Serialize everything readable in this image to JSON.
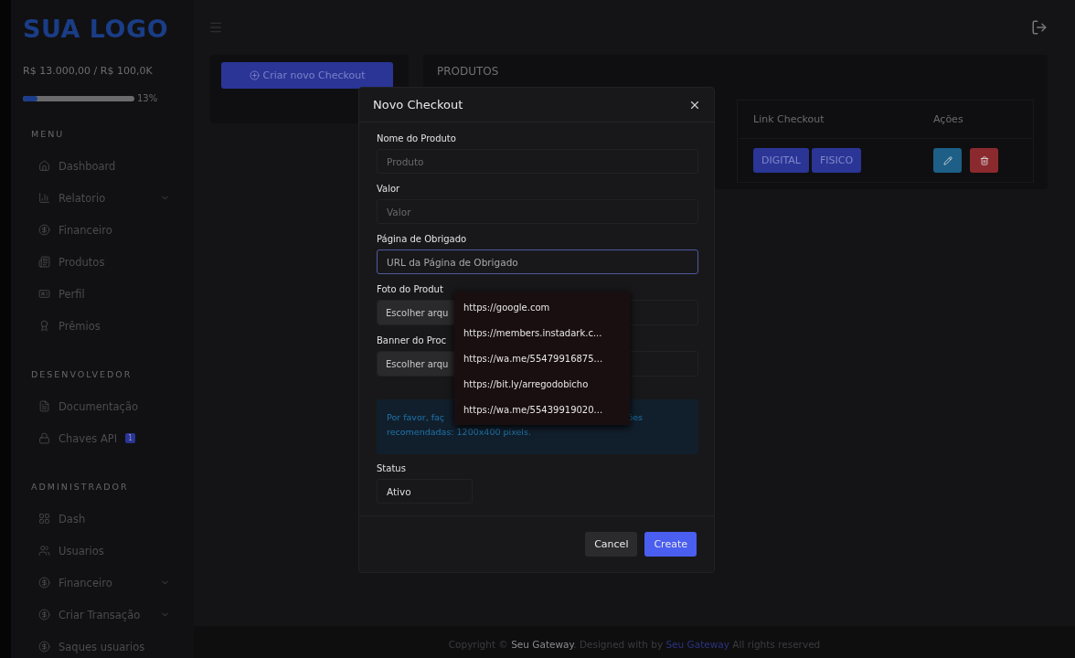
{
  "sidebar": {
    "logo": "SUA LOGO",
    "balance": "R$ 13.000,00 / R$ 100,0K",
    "progress": {
      "level": 0.13,
      "reading": "13%"
    },
    "sections": [
      {
        "title": "MENU",
        "items": [
          {
            "label": "Dashboard",
            "kind": "home",
            "expandable": false
          },
          {
            "label": "Relatorio",
            "kind": "chart",
            "expandable": true
          },
          {
            "label": "Financeiro",
            "kind": "dollar",
            "expandable": false
          },
          {
            "label": "Produtos",
            "kind": "news",
            "expandable": false
          },
          {
            "label": "Perfil",
            "kind": "card",
            "expandable": false
          },
          {
            "label": "Prêmios",
            "kind": "award",
            "expandable": false
          }
        ]
      },
      {
        "title": "DESENVOLVEDOR",
        "items": [
          {
            "label": "Documentação",
            "kind": "doc",
            "expandable": false
          },
          {
            "label": "Chaves API",
            "kind": "lock",
            "expandable": false,
            "badge": "1"
          }
        ]
      },
      {
        "title": "ADMINISTRADOR",
        "items": [
          {
            "label": "Dash",
            "kind": "grid",
            "expandable": false
          },
          {
            "label": "Usuarios",
            "kind": "users",
            "expandable": false
          },
          {
            "label": "Financeiro",
            "kind": "dollar",
            "expandable": true
          },
          {
            "label": "Criar Transação",
            "kind": "dollar",
            "expandable": true
          },
          {
            "label": "Saques usuarios",
            "kind": "dollar",
            "expandable": false
          }
        ]
      }
    ]
  },
  "create_button": "Criar novo Checkout",
  "products": {
    "title": "PRODUTOS",
    "columns": [
      "Link Checkout",
      "Ações"
    ],
    "rows": [
      {
        "links": [
          "DIGITAL",
          "FISICO"
        ]
      }
    ]
  },
  "modal": {
    "title": "Novo Checkout",
    "fields": [
      {
        "kind": "text",
        "label": "Nome do Produto",
        "placeholder": "Produto",
        "focused": false
      },
      {
        "kind": "text",
        "label": "Valor",
        "placeholder": "Valor",
        "focused": false
      },
      {
        "kind": "text",
        "label": "Página de Obrigado",
        "placeholder": "URL da Página de Obrigado",
        "focused": true
      },
      {
        "kind": "file",
        "label": "Foto do Produt",
        "button": "Escolher arqu"
      },
      {
        "kind": "file",
        "label": "Banner do Proc",
        "button": "Escolher arqu"
      }
    ],
    "alert": {
      "start": "Por favor, faç",
      "end": "ões",
      "line_2": "recomendadas: 1200x400 pixels."
    },
    "status": {
      "label": "Status",
      "value": "Ativo"
    },
    "buttons": {
      "cancel": "Cancel",
      "create": "Create"
    },
    "suggestions": [
      "https://google.com",
      "https://members.instadark.c...",
      "https://wa.me/55479916875...",
      "https://bit.ly/arregodobicho",
      "https://wa.me/55439919020..."
    ]
  },
  "footer": {
    "text": "Copyright © **Seu Gateway**. Designed with by",
    "link": "Seu Gateway",
    "after": "All rights reserved"
  }
}
